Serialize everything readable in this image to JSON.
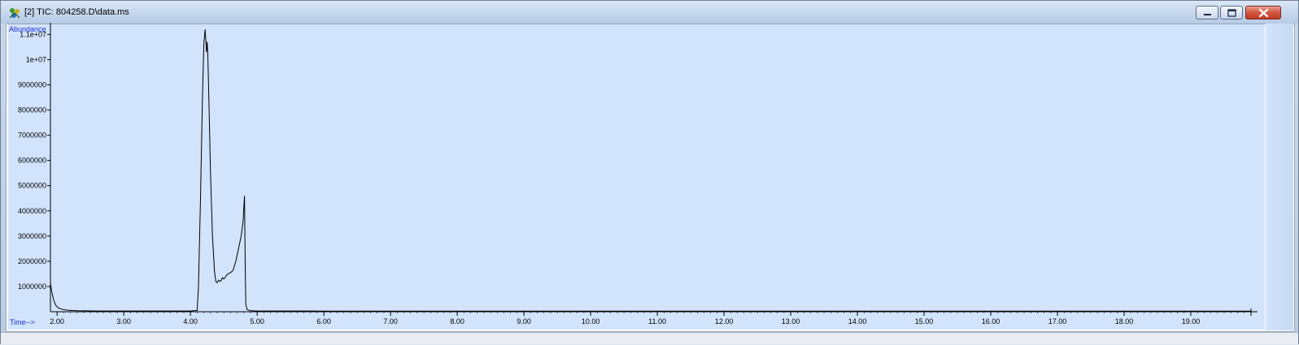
{
  "window": {
    "title": "[2] TIC: 804258.D\\data.ms",
    "icon": "chemstation-app-icon",
    "controls": {
      "minimize": "minimize-icon",
      "maximize": "maximize-icon",
      "close": "close-icon"
    }
  },
  "colors": {
    "plot_background": "#d2e3fc",
    "trace": "#000000",
    "axis_label": "#1a2fd4"
  },
  "chart_data": {
    "type": "line",
    "title": "",
    "ylabel": "Abundance",
    "xlabel": "Time-->",
    "xlim": [
      1.9,
      20.0
    ],
    "ylim": [
      0,
      11400000
    ],
    "x_ticks": [
      2.0,
      3.0,
      4.0,
      5.0,
      6.0,
      7.0,
      8.0,
      9.0,
      10.0,
      11.0,
      12.0,
      13.0,
      14.0,
      15.0,
      16.0,
      17.0,
      18.0,
      19.0
    ],
    "x_tick_labels": [
      "2.00",
      "3.00",
      "4.00",
      "5.00",
      "6.00",
      "7.00",
      "8.00",
      "9.00",
      "10.00",
      "11.00",
      "12.00",
      "13.00",
      "14.00",
      "15.00",
      "16.00",
      "17.00",
      "18.00",
      "19.00"
    ],
    "y_ticks": [
      1000000,
      2000000,
      3000000,
      4000000,
      5000000,
      6000000,
      7000000,
      8000000,
      9000000,
      10000000,
      11000000
    ],
    "y_tick_labels": [
      "1000000",
      "2000000",
      "3000000",
      "4000000",
      "5000000",
      "6000000",
      "7000000",
      "8000000",
      "9000000",
      "1e+07",
      "1.1e+07"
    ],
    "grid": false,
    "series": [
      {
        "x": [
          1.9,
          1.92,
          1.95,
          1.98,
          2.02,
          2.08,
          2.15,
          2.3,
          2.6,
          3.0,
          3.5,
          4.0,
          4.1,
          4.12,
          4.15,
          4.18,
          4.2,
          4.22,
          4.23,
          4.24,
          4.25,
          4.26,
          4.28,
          4.3,
          4.33,
          4.36,
          4.38,
          4.4,
          4.42,
          4.45,
          4.48,
          4.5,
          4.53,
          4.56,
          4.6,
          4.64,
          4.68,
          4.72,
          4.76,
          4.79,
          4.8,
          4.81,
          4.82,
          4.83,
          4.85,
          4.9,
          5.0,
          6.0,
          8.0,
          10.0,
          12.0,
          14.0,
          16.0,
          18.0,
          19.9
        ],
        "y": [
          1150000,
          800000,
          450000,
          250000,
          150000,
          90000,
          60000,
          40000,
          30000,
          30000,
          30000,
          30000,
          50000,
          1000000,
          4500000,
          8500000,
          10600000,
          11200000,
          10800000,
          10300000,
          10700000,
          10200000,
          8000000,
          5500000,
          3000000,
          1600000,
          1200000,
          1150000,
          1250000,
          1200000,
          1350000,
          1300000,
          1400000,
          1500000,
          1550000,
          1650000,
          2000000,
          2500000,
          3000000,
          3600000,
          4150000,
          4600000,
          2000000,
          300000,
          80000,
          40000,
          30000,
          25000,
          25000,
          25000,
          25000,
          25000,
          25000,
          25000,
          25000
        ]
      }
    ]
  }
}
